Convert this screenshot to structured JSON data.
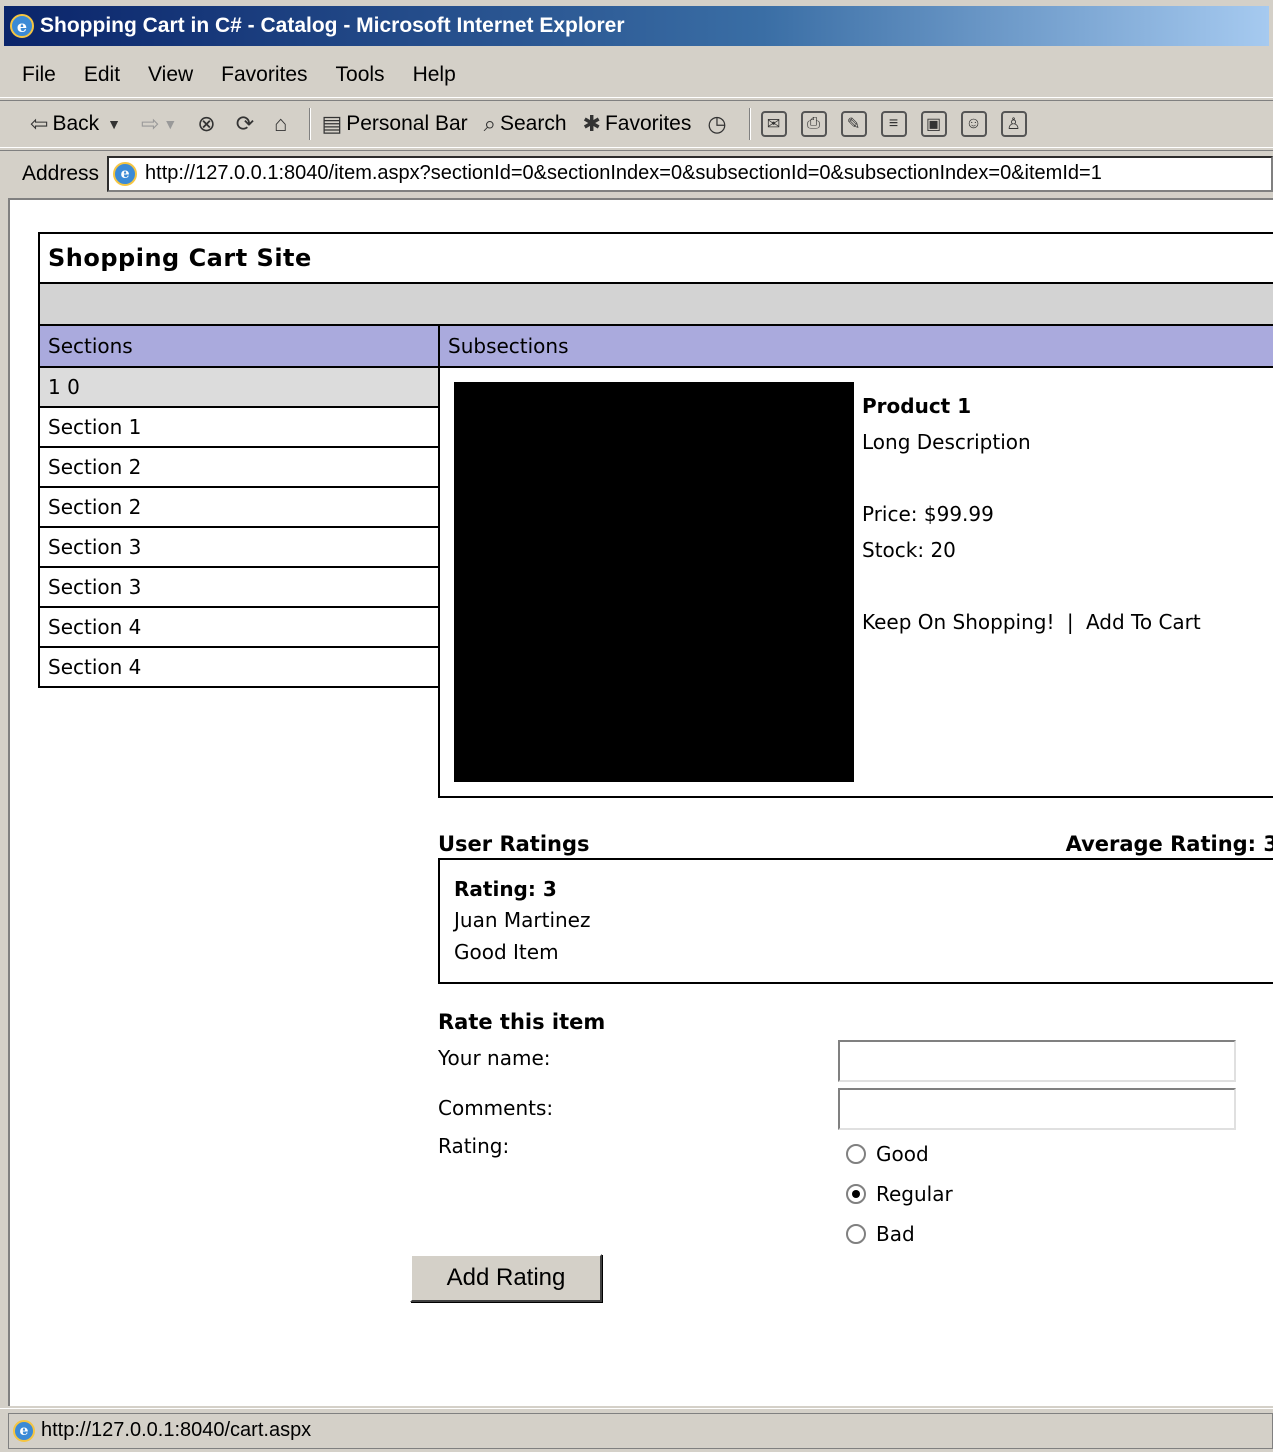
{
  "window": {
    "title": "Shopping Cart in C# - Catalog - Microsoft Internet Explorer",
    "icon": "ie-icon"
  },
  "menu": [
    "File",
    "Edit",
    "View",
    "Favorites",
    "Tools",
    "Help"
  ],
  "toolbar": {
    "back": "Back",
    "personal_bar": "Personal Bar",
    "search": "Search",
    "favorites": "Favorites"
  },
  "address": {
    "label": "Address",
    "url": "http://127.0.0.1:8040/item.aspx?sectionId=0&sectionIndex=0&subsectionId=0&subsectionIndex=0&itemId=1"
  },
  "site": {
    "title": "Shopping Cart Site"
  },
  "sections": {
    "header": "Sections",
    "items": [
      "1 0",
      "Section 1",
      "Section 2",
      "Section 2",
      "Section 3",
      "Section 3",
      "Section 4",
      "Section 4"
    ],
    "selected_index": 0
  },
  "subsections": {
    "header": "Subsections"
  },
  "product": {
    "name": "Product 1",
    "description": "Long Description",
    "price": "Price: $99.99",
    "stock": "Stock: 20",
    "keep_shopping": "Keep On Shopping!",
    "separator": "|",
    "add_to_cart": "Add To Cart"
  },
  "ratings": {
    "header": "User Ratings",
    "average": "Average Rating: 3",
    "entries": [
      {
        "rating": "Rating: 3",
        "user": "Juan Martinez",
        "comment": "Good Item"
      }
    ]
  },
  "rate_form": {
    "title": "Rate this item",
    "name_label": "Your name:",
    "name_value": "",
    "comments_label": "Comments:",
    "comments_value": "",
    "rating_label": "Rating:",
    "options": [
      "Good",
      "Regular",
      "Bad"
    ],
    "selected_option": "Regular",
    "submit_label": "Add Rating"
  },
  "status": {
    "text": "http://127.0.0.1:8040/cart.aspx"
  }
}
